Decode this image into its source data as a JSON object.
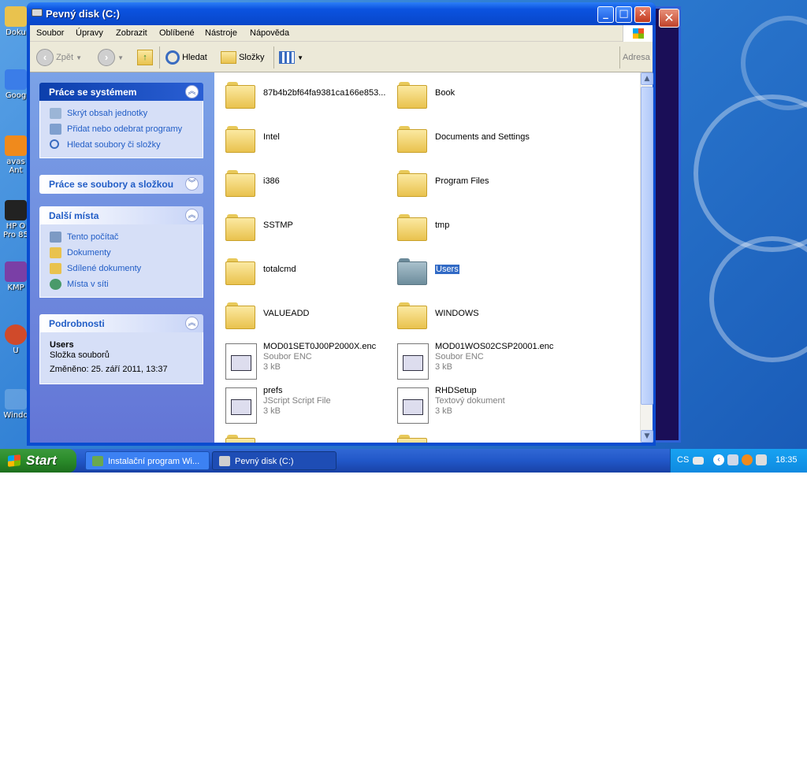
{
  "window": {
    "title": "Pevný disk (C:)"
  },
  "menu": [
    "Soubor",
    "Úpravy",
    "Zobrazit",
    "Oblíbené",
    "Nástroje",
    "Nápověda"
  ],
  "toolbar": {
    "back": "Zpět",
    "search": "Hledat",
    "folders": "Složky",
    "address": "Adresa"
  },
  "sidebar": {
    "system": {
      "title": "Práce se systémem",
      "links": [
        "Skrýt obsah jednotky",
        "Přidat nebo odebrat programy",
        "Hledat soubory či složky"
      ]
    },
    "files": {
      "title": "Práce se soubory a složkou"
    },
    "places": {
      "title": "Další místa",
      "links": [
        "Tento počítač",
        "Dokumenty",
        "Sdílené dokumenty",
        "Místa v síti"
      ]
    },
    "details": {
      "title": "Podrobnosti",
      "name": "Users",
      "type": "Složka souborů",
      "modified": "Změněno: 25. září 2011, 13:37"
    }
  },
  "items": [
    {
      "name": "87b4b2bf64fa9381ca166e853...",
      "kind": "folder"
    },
    {
      "name": "Book",
      "kind": "folder"
    },
    {
      "name": "Intel",
      "kind": "folder"
    },
    {
      "name": "Documents and Settings",
      "kind": "folder"
    },
    {
      "name": "i386",
      "kind": "folder"
    },
    {
      "name": "Program Files",
      "kind": "folder"
    },
    {
      "name": "SSTMP",
      "kind": "folder"
    },
    {
      "name": "tmp",
      "kind": "folder"
    },
    {
      "name": "totalcmd",
      "kind": "folder"
    },
    {
      "name": "Users",
      "kind": "folder",
      "selected": true
    },
    {
      "name": "VALUEADD",
      "kind": "folder"
    },
    {
      "name": "WINDOWS",
      "kind": "folder"
    },
    {
      "name": "MOD01SET0J00P2000X.enc",
      "type": "Soubor ENC",
      "size": "3 kB"
    },
    {
      "name": "MOD01WOS02CSP20001.enc",
      "type": "Soubor ENC",
      "size": "3 kB"
    },
    {
      "name": "prefs",
      "type": "JScript Script File",
      "size": "3 kB"
    },
    {
      "name": "RHDSetup",
      "type": "Textový dokument",
      "size": "3 kB"
    }
  ],
  "desktop_icons": [
    {
      "label": "Doku"
    },
    {
      "label": "Goog"
    },
    {
      "label": "avas Ant"
    },
    {
      "label": "HP O Pro 85"
    },
    {
      "label": "KMP"
    },
    {
      "label": "U"
    },
    {
      "label": "Windo"
    }
  ],
  "taskbar": {
    "start": "Start",
    "tasks": [
      {
        "label": "Instalační program Wi..."
      },
      {
        "label": "Pevný disk (C:)"
      }
    ],
    "lang": "CS",
    "clock": "18:35"
  },
  "colors": {
    "titlebar": "#0b53e0",
    "sidebar": "#6375d6",
    "link": "#215dc6",
    "selection": "#316ac5",
    "start": "#2a8a2a",
    "tray": "#0f8ae0"
  }
}
